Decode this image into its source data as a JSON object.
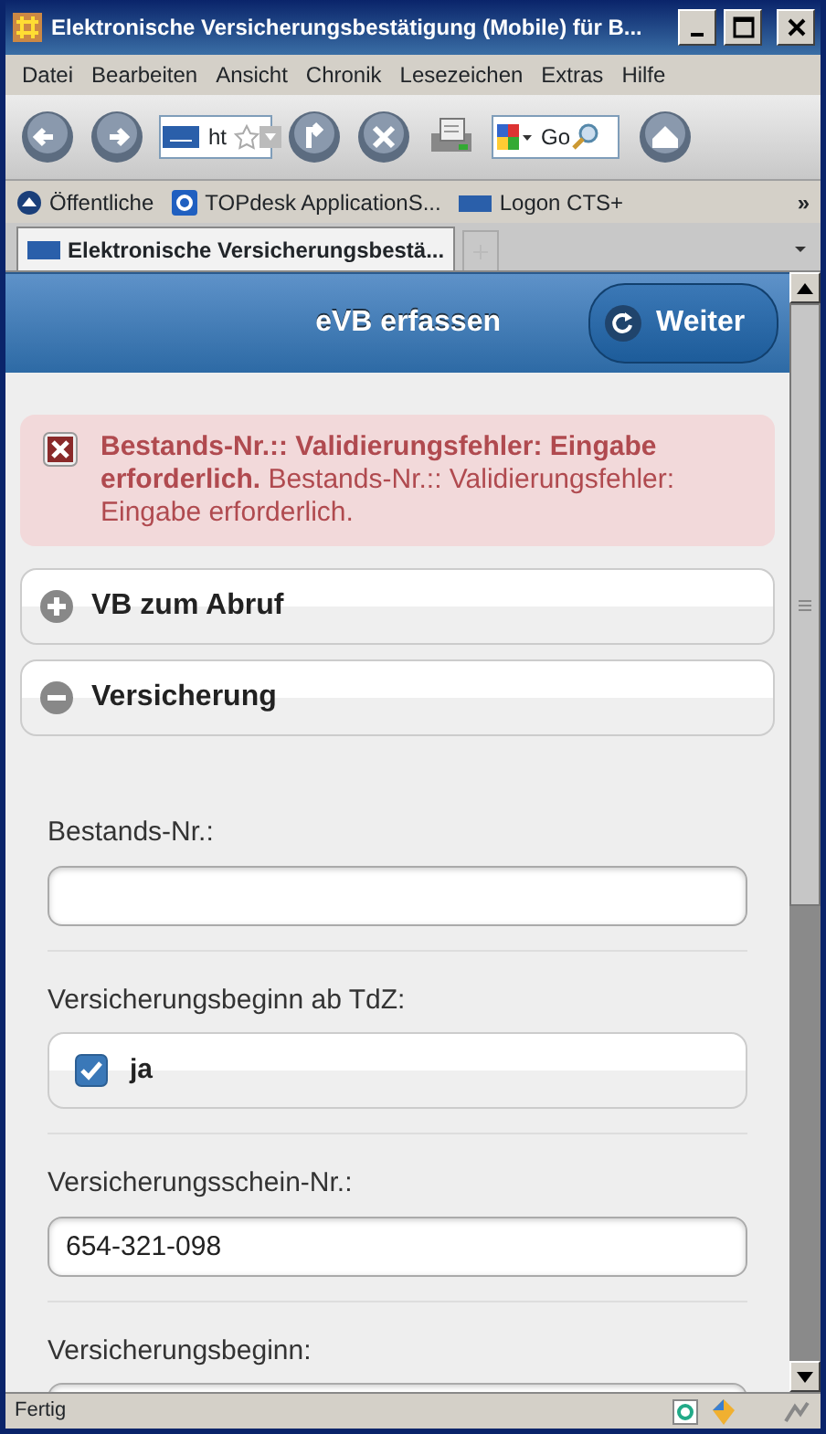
{
  "window": {
    "title": "Elektronische Versicherungsbestätigung (Mobile) für B..."
  },
  "menu": [
    "Datei",
    "Bearbeiten",
    "Ansicht",
    "Chronik",
    "Lesezeichen",
    "Extras",
    "Hilfe"
  ],
  "toolbar": {
    "address": "ht",
    "search": "Go"
  },
  "bookmarks": {
    "items": [
      "Öffentliche",
      "TOPdesk ApplicationS...",
      "Logon CTS+"
    ],
    "overflow": "»"
  },
  "tabs": [
    {
      "label": "Elektronische Versicherungsbestä...",
      "selected": true
    }
  ],
  "page": {
    "title": "eVB erfassen",
    "button": "Weiter",
    "error": "**Bestands-Nr.:: Validierungsfehler: Eingabe erforderlich.** Bestands-Nr.:: Validierungsfehler: Eingabe erforderlich.",
    "sections": [
      {
        "title": "VB zum Abruf",
        "expanded": false
      },
      {
        "title": "Versicherung",
        "expanded": true
      }
    ],
    "fields": [
      {
        "kind": "text",
        "label": "Bestands-Nr.:"
      },
      {
        "kind": "checkbox",
        "label": "Versicherungsbeginn ab TdZ:",
        "option": "ja",
        "checked": true
      },
      {
        "kind": "text",
        "label": "Versicherungsschein-Nr.:",
        "value": "654-321-098"
      },
      {
        "kind": "text",
        "label": "Versicherungsbeginn:"
      }
    ]
  },
  "status_bar": "Fertig"
}
